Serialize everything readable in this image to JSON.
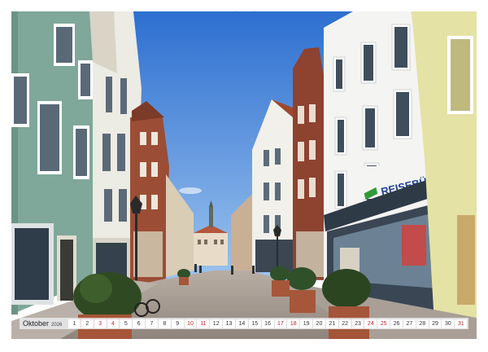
{
  "calendar": {
    "month": "Oktober",
    "year": "2026",
    "days": [
      {
        "n": "1",
        "w": false
      },
      {
        "n": "2",
        "w": false
      },
      {
        "n": "3",
        "w": true
      },
      {
        "n": "4",
        "w": true
      },
      {
        "n": "5",
        "w": false
      },
      {
        "n": "6",
        "w": false
      },
      {
        "n": "7",
        "w": false
      },
      {
        "n": "8",
        "w": false
      },
      {
        "n": "9",
        "w": false
      },
      {
        "n": "10",
        "w": true
      },
      {
        "n": "11",
        "w": true
      },
      {
        "n": "12",
        "w": false
      },
      {
        "n": "13",
        "w": false
      },
      {
        "n": "14",
        "w": false
      },
      {
        "n": "15",
        "w": false
      },
      {
        "n": "16",
        "w": false
      },
      {
        "n": "17",
        "w": true
      },
      {
        "n": "18",
        "w": true
      },
      {
        "n": "19",
        "w": false
      },
      {
        "n": "20",
        "w": false
      },
      {
        "n": "21",
        "w": false
      },
      {
        "n": "22",
        "w": false
      },
      {
        "n": "23",
        "w": false
      },
      {
        "n": "24",
        "w": true
      },
      {
        "n": "25",
        "w": true
      },
      {
        "n": "26",
        "w": false
      },
      {
        "n": "27",
        "w": false
      },
      {
        "n": "28",
        "w": false
      },
      {
        "n": "29",
        "w": false
      },
      {
        "n": "30",
        "w": false
      },
      {
        "n": "31",
        "w": true
      }
    ]
  },
  "photo": {
    "shop_sign": "REISEBÜRO"
  },
  "colors": {
    "sky": "#3a7fd9",
    "weekend": "#c0262d"
  }
}
